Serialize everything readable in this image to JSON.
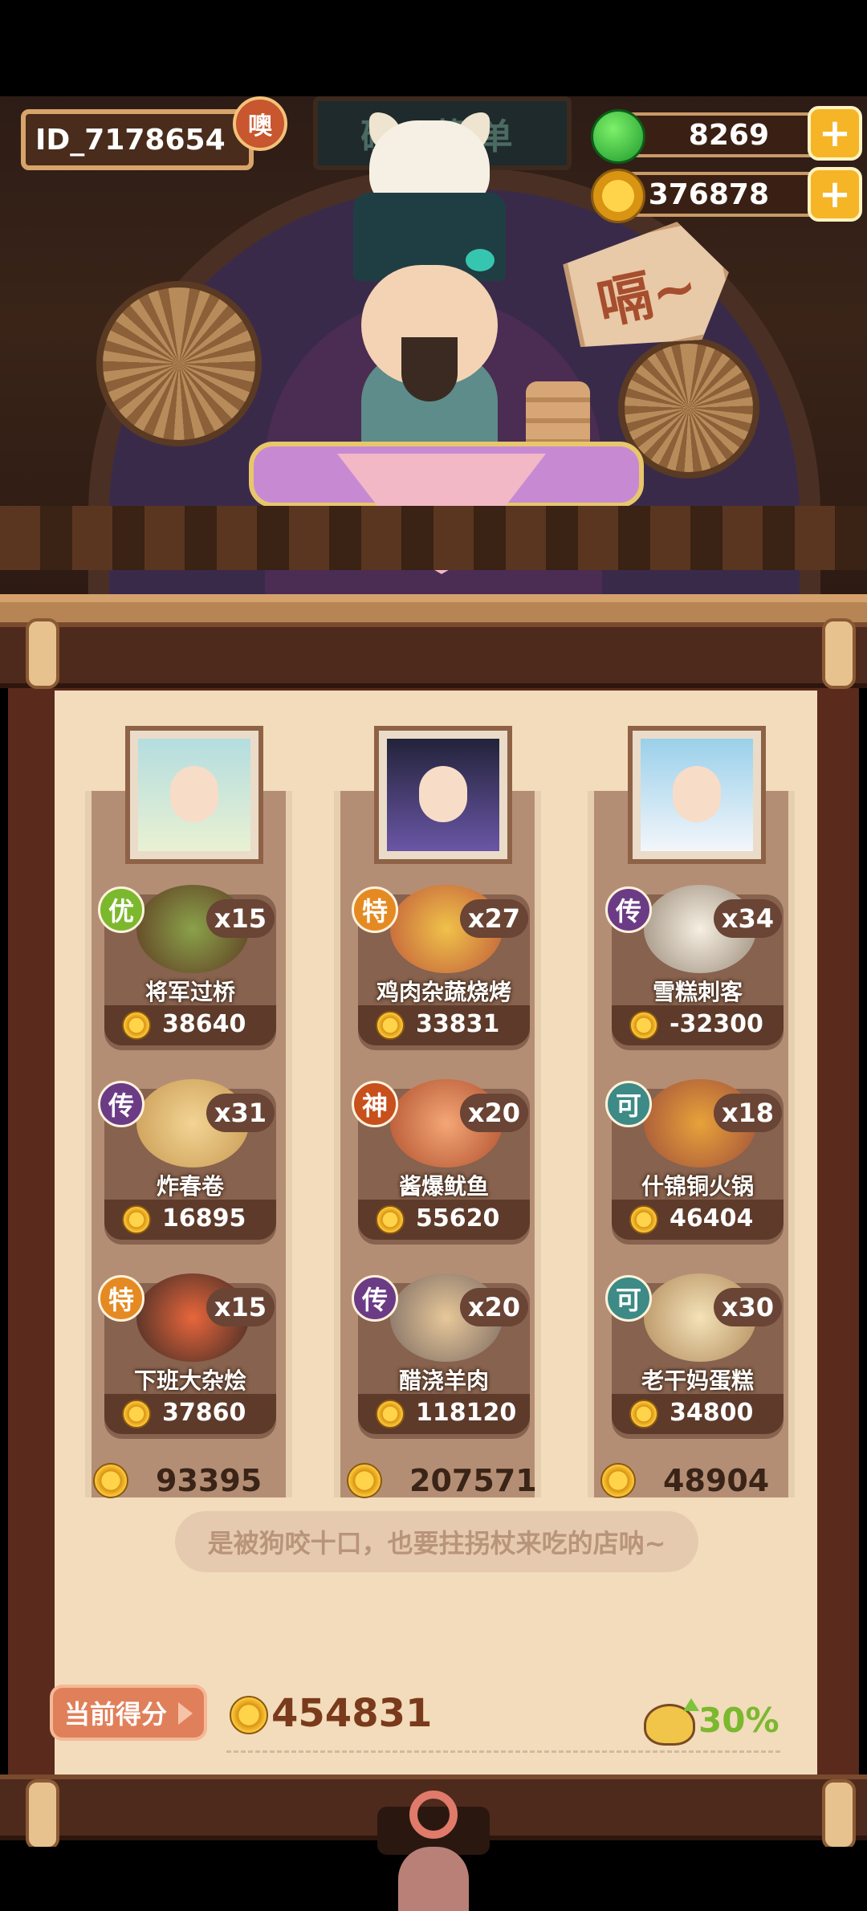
{
  "player": {
    "id": "ID_7178654",
    "badge": "噢"
  },
  "resources": [
    {
      "icon": "apple-icon",
      "value": "8269"
    },
    {
      "icon": "coin-icon",
      "value": "376878"
    }
  ],
  "scene": {
    "shop_sign": "碗 菜单",
    "sound_sign": "嗝~"
  },
  "columns": [
    {
      "total": "93395",
      "dishes": [
        {
          "grade": "优",
          "count": "x15",
          "name": "将军过桥",
          "price": "38640",
          "color": "#8aa24a"
        },
        {
          "grade": "传",
          "count": "x31",
          "name": "炸春卷",
          "price": "16895",
          "color": "#e8c07a"
        },
        {
          "grade": "特",
          "count": "x15",
          "name": "下班大杂烩",
          "price": "37860",
          "color": "#d9603a"
        }
      ]
    },
    {
      "total": "207571",
      "dishes": [
        {
          "grade": "特",
          "count": "x27",
          "name": "鸡肉杂蔬烧烤",
          "price": "33831",
          "color": "#e7b340"
        },
        {
          "grade": "神",
          "count": "x20",
          "name": "酱爆鱿鱼",
          "price": "55620",
          "color": "#e29466"
        },
        {
          "grade": "传",
          "count": "x20",
          "name": "醋浇羊肉",
          "price": "118120",
          "color": "#c9a27a"
        }
      ]
    },
    {
      "total": "48904",
      "dishes": [
        {
          "grade": "传",
          "count": "x34",
          "name": "雪糕刺客",
          "price": "-32300",
          "color": "#efe6d8"
        },
        {
          "grade": "可",
          "count": "x18",
          "name": "什锦铜火锅",
          "price": "46404",
          "color": "#d8a03a"
        },
        {
          "grade": "可",
          "count": "x30",
          "name": "老干妈蛋糕",
          "price": "34800",
          "color": "#e9d4a8"
        }
      ]
    }
  ],
  "quote": "是被狗咬十口，也要拄拐杖来吃的店呐~",
  "score": {
    "label": "当前得分",
    "value": "454831",
    "bonus": "30%"
  }
}
